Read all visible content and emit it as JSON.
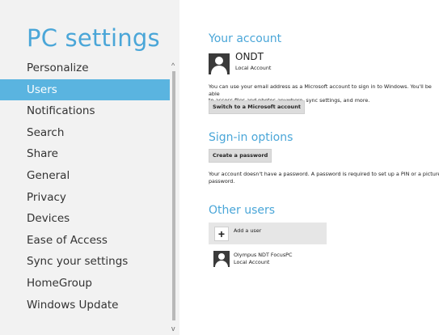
{
  "sidebar": {
    "title": "PC settings",
    "items": [
      {
        "label": "Personalize"
      },
      {
        "label": "Users"
      },
      {
        "label": "Notifications"
      },
      {
        "label": "Search"
      },
      {
        "label": "Share"
      },
      {
        "label": "General"
      },
      {
        "label": "Privacy"
      },
      {
        "label": "Devices"
      },
      {
        "label": "Ease of Access"
      },
      {
        "label": "Sync your settings"
      },
      {
        "label": "HomeGroup"
      },
      {
        "label": "Windows Update"
      }
    ],
    "scroll_up_glyph": "^",
    "scroll_down_glyph": "v"
  },
  "account": {
    "heading": "Your account",
    "username": "ONDT",
    "account_type": "Local Account",
    "description_line1": "You can use your email address as a Microsoft account to sign in to Windows. You'll be able",
    "description_line2": "to access files and photos anywhere, sync settings, and more.",
    "switch_button": "Switch to a Microsoft account"
  },
  "signin": {
    "heading": "Sign-in options",
    "create_password_button": "Create a password",
    "note_line1": "Your account doesn't have a password. A password is required to set up a PIN or a picture",
    "note_line2": "password."
  },
  "other_users": {
    "heading": "Other users",
    "add_user_label": "Add a user",
    "add_user_glyph": "+",
    "users": [
      {
        "name": "Olympus NDT FocusPC",
        "type": "Local Account"
      }
    ]
  },
  "colors": {
    "accent": "#4aa6d8",
    "selected_bg": "#5ab4e0",
    "sidebar_bg": "#f2f2f2"
  }
}
